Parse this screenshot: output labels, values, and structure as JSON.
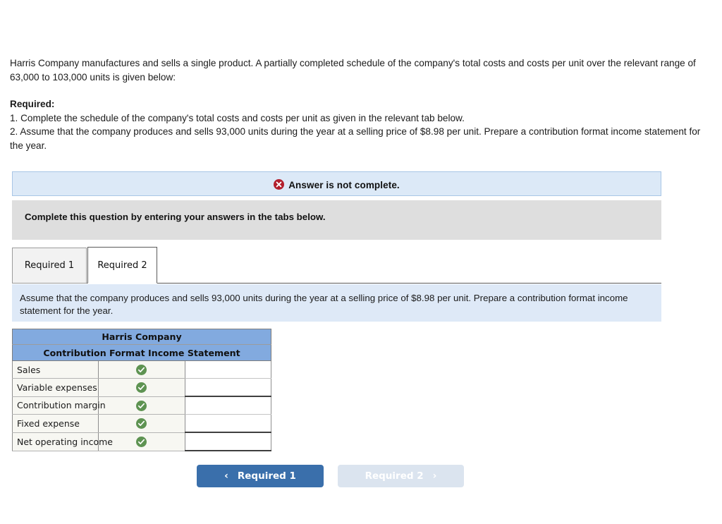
{
  "problem": {
    "intro": "Harris Company manufactures and sells a single product. A partially completed schedule of the company's total costs and costs per unit over the relevant range of 63,000 to 103,000 units is given below:",
    "required_heading": "Required:",
    "req1": "1. Complete the schedule of the company's total costs and costs per unit as given in the relevant tab below.",
    "req2": "2. Assume that the company produces and sells 93,000 units during the year at a selling price of $8.98 per unit. Prepare a contribution format income statement for the year."
  },
  "banner": {
    "text": "Answer is not complete.",
    "icon": "error-x-icon",
    "background": "#dce9f7",
    "border": "#a8c6e6",
    "icon_color": "#b21f2d"
  },
  "instruction_bar": {
    "text": "Complete this question by entering your answers in the tabs below.",
    "background": "#dedede"
  },
  "tabs": [
    {
      "label": "Required 1",
      "active": false
    },
    {
      "label": "Required 2",
      "active": true
    }
  ],
  "sub_instruction": {
    "text": "Assume that the company produces and sells 93,000 units during the year at a selling price of $8.98 per unit. Prepare a contribution format income statement for the year.",
    "background": "#dee9f7"
  },
  "statement": {
    "header_company": "Harris Company",
    "header_title": "Contribution Format Income Statement",
    "header_background": "#82aadf",
    "rows": [
      {
        "label": "Sales",
        "status_icon": "check-circle-icon",
        "value": ""
      },
      {
        "label": "Variable expenses",
        "status_icon": "check-circle-icon",
        "value": ""
      },
      {
        "label": "Contribution margin",
        "status_icon": "check-circle-icon",
        "value": ""
      },
      {
        "label": "Fixed expense",
        "status_icon": "check-circle-icon",
        "value": ""
      },
      {
        "label": "Net operating income",
        "status_icon": "check-circle-icon",
        "value": ""
      }
    ],
    "status_icon_color": "#5e9352"
  },
  "navigation": {
    "prev_label": "Required 1",
    "prev_icon": "chevron-left-icon",
    "prev_background": "#3a6fab",
    "next_label": "Required 2",
    "next_icon": "chevron-right-icon",
    "next_background": "#dbe4ef"
  }
}
